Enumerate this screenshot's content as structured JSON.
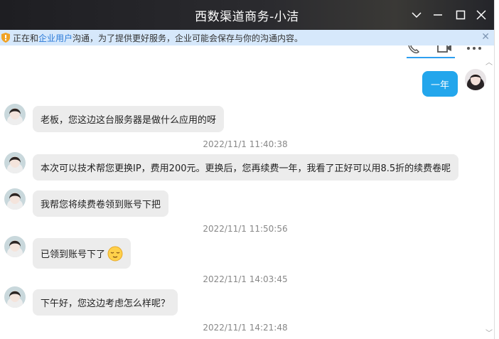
{
  "window": {
    "title": "西数渠道商务-小洁"
  },
  "notice": {
    "prefix": "正在和",
    "link": "企业用户",
    "suffix": "沟通，为了提供更好服务，企业可能会保存与你的沟通内容。",
    "close_icon": "close-icon"
  },
  "messages": [
    {
      "dir": "sent",
      "text": "一年"
    },
    {
      "dir": "received",
      "text": "老板，您这边这台服务器是做什么应用的呀"
    },
    {
      "type": "time",
      "text": "2022/11/1 11:40:38"
    },
    {
      "dir": "received",
      "text": "本次可以技术帮您更换IP，费用200元。更换后，您再续费一年，我看了正好可以用8.5折的续费卷呢"
    },
    {
      "dir": "received",
      "text": "我帮您将续费卷领到账号下把"
    },
    {
      "type": "time",
      "text": "2022/11/1 11:50:56"
    },
    {
      "dir": "received",
      "text": "已领到账号下了",
      "emoji": "relieved-face"
    },
    {
      "type": "time",
      "text": "2022/11/1 14:03:45"
    },
    {
      "dir": "received",
      "text": "下午好，您这边考虑怎么样呢？"
    },
    {
      "type": "time",
      "text": "2022/11/1 14:21:48"
    }
  ],
  "colors": {
    "sent_bubble": "#23a6ec",
    "received_bubble": "#ececec",
    "notice_bg": "#d6e8fb",
    "link": "#2a7ad8"
  }
}
